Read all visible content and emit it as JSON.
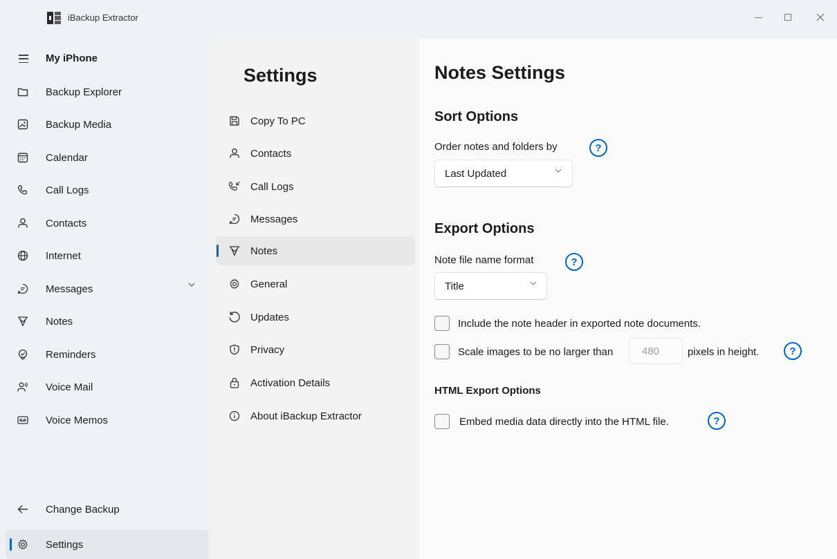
{
  "window": {
    "title": "iBackup Extractor",
    "icons": {
      "minimize": "minimize-icon",
      "maximize": "maximize-icon",
      "close": "close-icon"
    }
  },
  "nav": {
    "header": {
      "label": "My iPhone",
      "icon": "hamburger-icon"
    },
    "items": [
      {
        "label": "Backup Explorer",
        "icon": "folder-icon"
      },
      {
        "label": "Backup Media",
        "icon": "image-icon"
      },
      {
        "label": "Calendar",
        "icon": "calendar-icon"
      },
      {
        "label": "Call Logs",
        "icon": "phone-icon"
      },
      {
        "label": "Contacts",
        "icon": "person-icon"
      },
      {
        "label": "Internet",
        "icon": "globe-icon"
      },
      {
        "label": "Messages",
        "icon": "chat-icon",
        "expandable": true
      },
      {
        "label": "Notes",
        "icon": "notes-icon"
      },
      {
        "label": "Reminders",
        "icon": "reminder-icon"
      },
      {
        "label": "Voice Mail",
        "icon": "voicemail-icon"
      },
      {
        "label": "Voice Memos",
        "icon": "voicememo-icon"
      }
    ],
    "footer": [
      {
        "label": "Change Backup",
        "icon": "arrow-left-icon"
      },
      {
        "label": "Settings",
        "icon": "gear-icon",
        "selected": true
      }
    ]
  },
  "settings": {
    "title": "Settings",
    "selected": "Notes",
    "items": [
      {
        "label": "Copy To PC",
        "icon": "save-icon"
      },
      {
        "label": "Contacts",
        "icon": "person-icon"
      },
      {
        "label": "Call Logs",
        "icon": "call-logs-icon"
      },
      {
        "label": "Messages",
        "icon": "chat-icon"
      },
      {
        "label": "Notes",
        "icon": "notes-icon"
      },
      {
        "label": "General",
        "icon": "gear-icon"
      },
      {
        "label": "Updates",
        "icon": "refresh-icon"
      },
      {
        "label": "Privacy",
        "icon": "shield-icon"
      },
      {
        "label": "Activation Details",
        "icon": "lock-icon"
      },
      {
        "label": "About iBackup Extractor",
        "icon": "info-icon"
      }
    ]
  },
  "notes_settings": {
    "title": "Notes Settings",
    "help_glyph": "?",
    "sort": {
      "title": "Sort Options",
      "order_label": "Order notes and folders by",
      "order_value": "Last Updated"
    },
    "export": {
      "title": "Export Options",
      "filename_label": "Note file name format",
      "filename_value": "Title",
      "include_header_label": "Include the note header in exported note documents.",
      "include_header_checked": false,
      "scale_prefix": "Scale images to be no larger than",
      "scale_placeholder": "480",
      "scale_suffix": "pixels in height.",
      "scale_checked": false
    },
    "html_export": {
      "title": "HTML Export Options",
      "embed_label": "Embed media data directly into the HTML file.",
      "embed_checked": false
    }
  },
  "colors": {
    "accent": "#0067c0",
    "nav_bg": "#eef1f6",
    "pane_bg": "#f3f3f3",
    "content_bg": "#fbfbfb"
  }
}
